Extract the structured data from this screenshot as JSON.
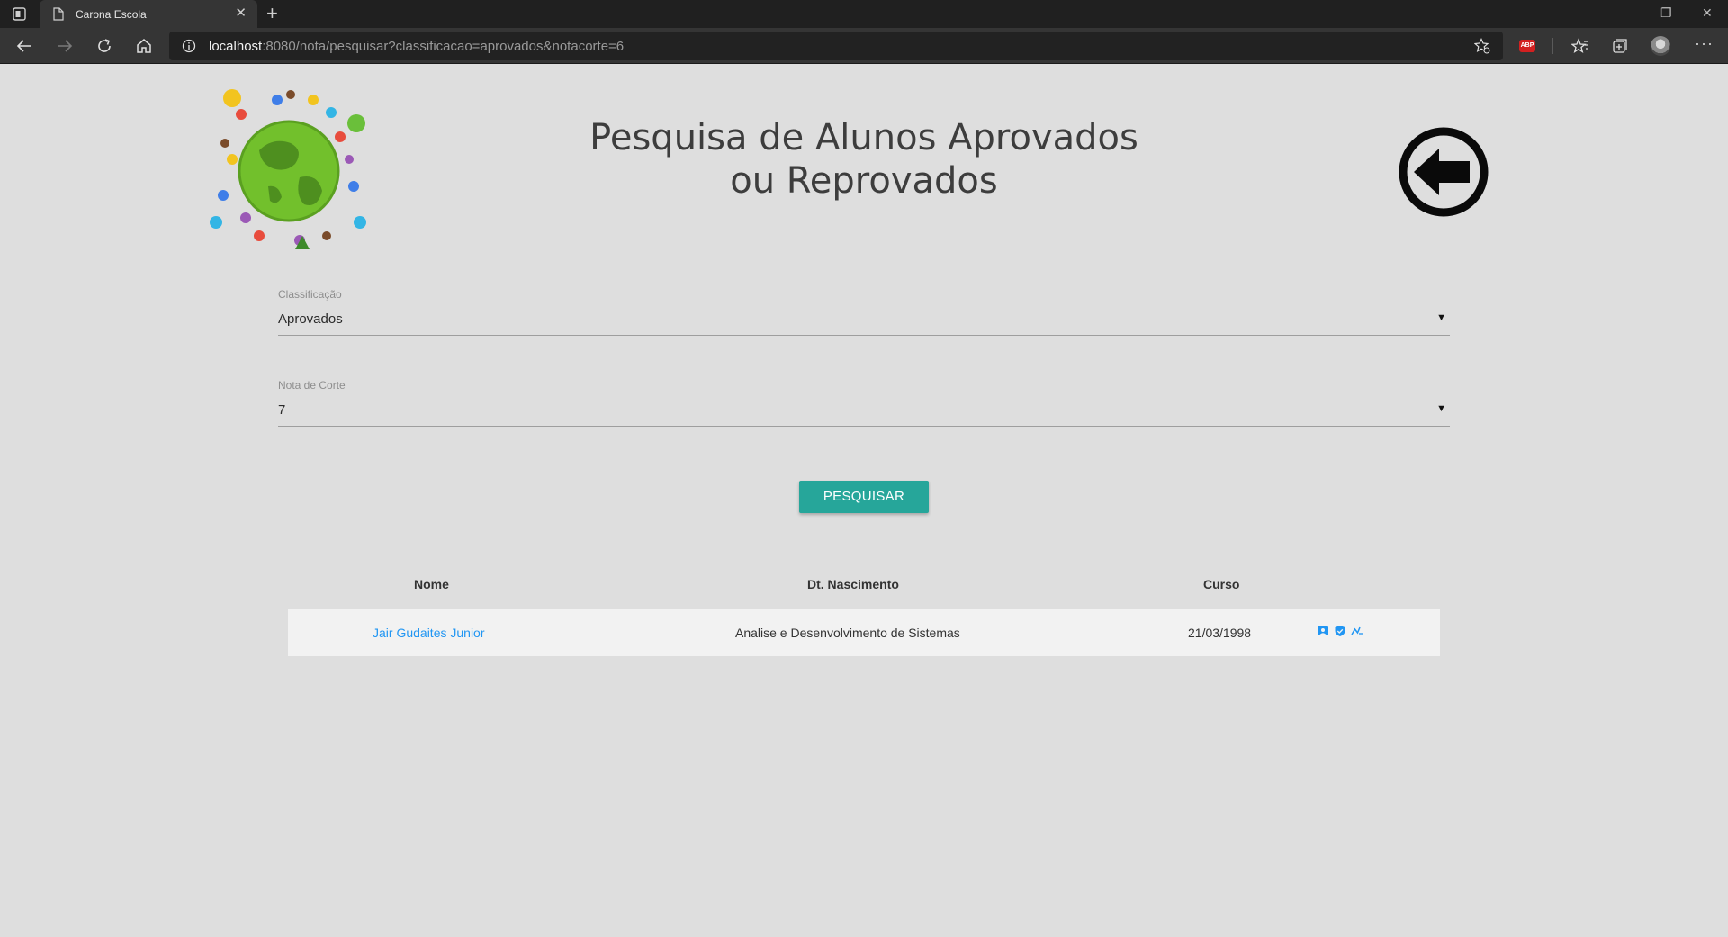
{
  "browser": {
    "tab_title": "Carona Escola",
    "tab_close": "✕",
    "new_tab": "+",
    "url_host": "localhost",
    "url_rest": ":8080/nota/pesquisar?classificacao=aprovados&notacorte=6",
    "abp_label": "ABP",
    "more_label": "···",
    "window_buttons": {
      "minimize": "—",
      "restore": "❐",
      "close": "✕"
    }
  },
  "page": {
    "title_line1": "Pesquisa de Alunos Aprovados",
    "title_line2": "ou Reprovados"
  },
  "form": {
    "classificacao": {
      "label": "Classificação",
      "value": "Aprovados"
    },
    "nota_corte": {
      "label": "Nota de Corte",
      "value": "7"
    },
    "caret": "▼",
    "search_button": "PESQUISAR"
  },
  "table": {
    "headers": [
      "Nome",
      "Dt. Nascimento",
      "Curso"
    ],
    "rows": [
      {
        "nome": "Jair Gudaites Junior",
        "col2": "Analise e Desenvolvimento de Sistemas",
        "col3": "21/03/1998"
      }
    ]
  },
  "icons": {
    "row_actions": [
      "contact-card-icon",
      "shield-check-icon",
      "chart-line-icon"
    ],
    "accent": "#2196f3",
    "button_color": "#26a69a"
  }
}
